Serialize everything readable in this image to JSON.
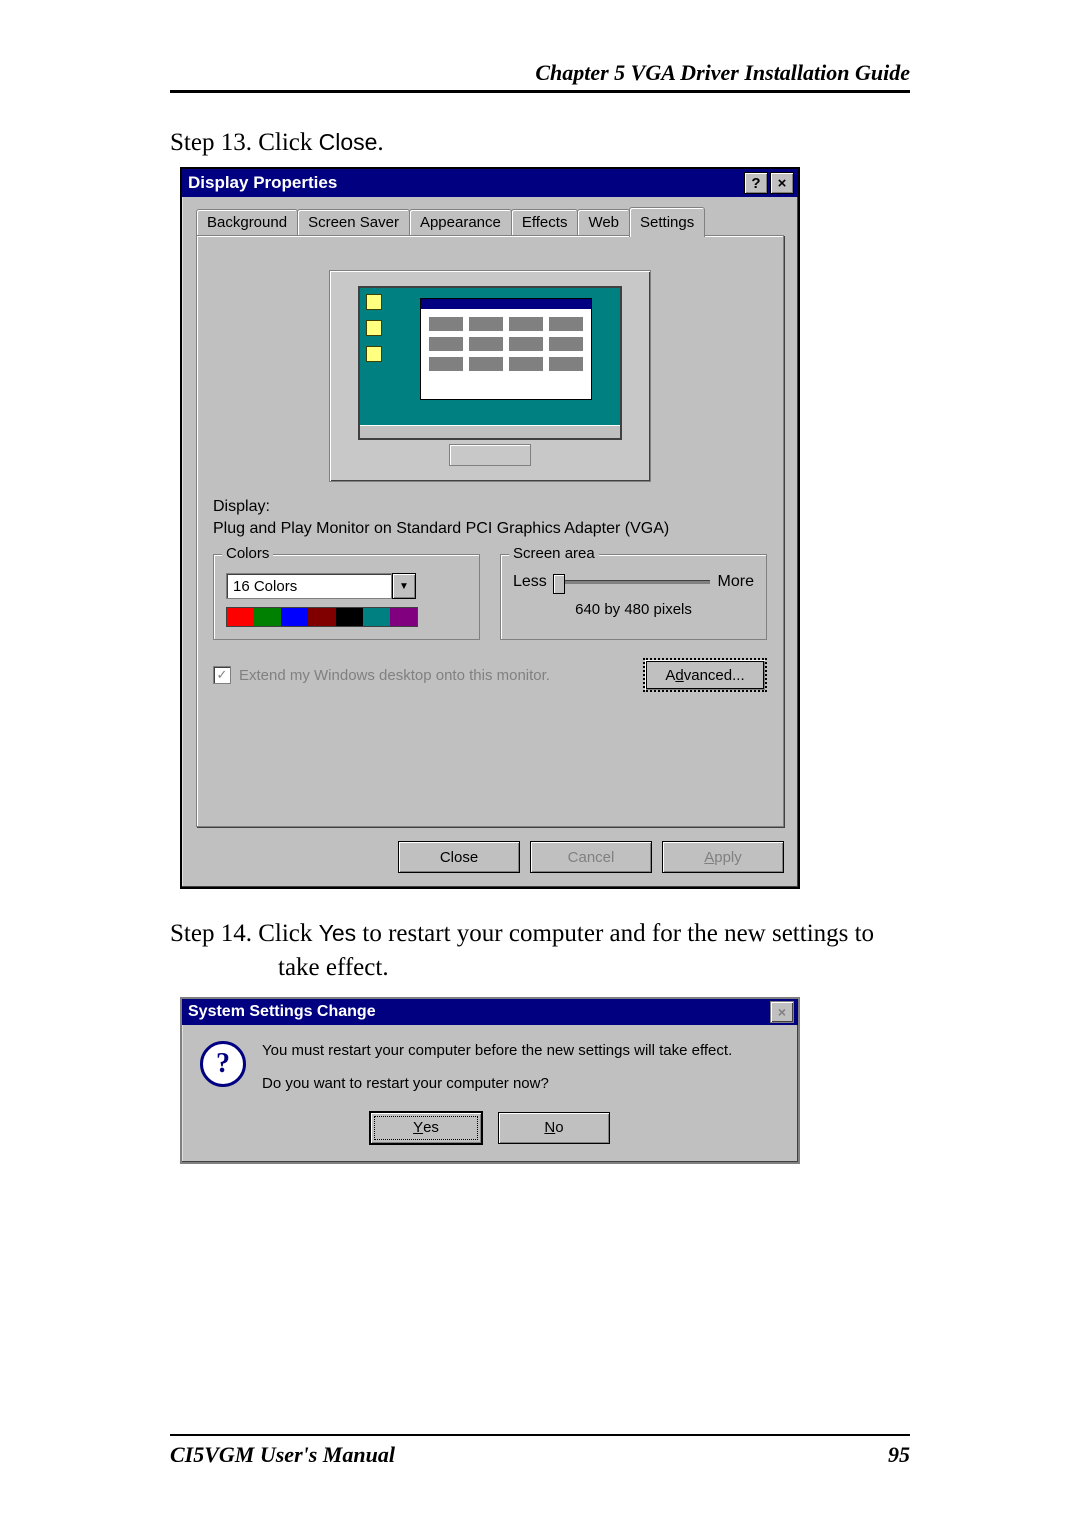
{
  "header": {
    "chapter_title": "Chapter 5  VGA Driver Installation Guide"
  },
  "step13": {
    "prefix": "Step 13.  Click ",
    "action": "Close",
    "suffix": "."
  },
  "display_dialog": {
    "title": "Display Properties",
    "help_symbol": "?",
    "close_symbol": "×",
    "tabs": {
      "background": "Background",
      "screensaver": "Screen Saver",
      "appearance": "Appearance",
      "effects": "Effects",
      "web": "Web",
      "settings": "Settings"
    },
    "display_label": "Display:",
    "display_value": "Plug and Play Monitor on Standard PCI Graphics Adapter (VGA)",
    "colors_group": {
      "legend": "Colors",
      "value": "16 Colors"
    },
    "screen_area_group": {
      "legend": "Screen area",
      "less": "Less",
      "more": "More",
      "resolution": "640 by 480 pixels"
    },
    "extend_label": "Extend my Windows desktop onto this monitor.",
    "advanced_btn": "Advanced...",
    "close_btn": "Close",
    "cancel_btn": "Cancel",
    "apply_btn": "Apply"
  },
  "step14": {
    "prefix": "Step 14.   Click ",
    "action": "Yes",
    "middle": " to restart your computer and for the new settings to",
    "line2": "take effect."
  },
  "settings_dialog": {
    "title": "System Settings Change",
    "close_symbol": "×",
    "icon_char": "?",
    "message_line1": "You must restart your computer before the new settings will take effect.",
    "message_line2": "Do you want to restart your computer now?",
    "yes_btn": "Yes",
    "no_btn": "No"
  },
  "footer": {
    "manual": "CI5VGM User's Manual",
    "page": "95"
  },
  "color_swatches": [
    "#ff0000",
    "#008000",
    "#0000ff",
    "#800000",
    "#000000",
    "#008080",
    "#800080",
    "#ffff00"
  ]
}
